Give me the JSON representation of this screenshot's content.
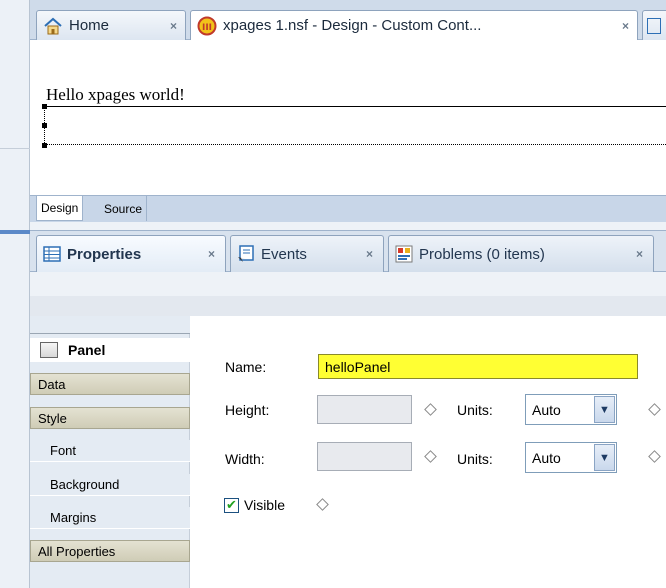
{
  "editor_tabs": [
    {
      "label": "Home",
      "close": "×",
      "icon": "home-icon"
    },
    {
      "label": "xpages 1.nsf - Design - Custom Cont...",
      "close": "×",
      "icon": "domino-database-icon"
    }
  ],
  "canvas": {
    "hello_text": "Hello xpages world!"
  },
  "design_tabs": [
    "Design",
    "Source"
  ],
  "view_tabs": [
    {
      "label": "Properties",
      "close": "×",
      "icon": "properties-icon"
    },
    {
      "label": "Events",
      "close": "×",
      "icon": "events-icon"
    },
    {
      "label": "Problems (0 items)",
      "close": "×",
      "icon": "problems-icon"
    }
  ],
  "sidenav": {
    "header": "Panel",
    "items": [
      {
        "label": "Data",
        "kind": "category"
      },
      {
        "label": "Style",
        "kind": "category"
      },
      {
        "label": "Font",
        "kind": "sub"
      },
      {
        "label": "Background",
        "kind": "sub"
      },
      {
        "label": "Margins",
        "kind": "sub"
      },
      {
        "label": "All Properties",
        "kind": "category"
      }
    ]
  },
  "form": {
    "name_label": "Name:",
    "name_value": "helloPanel",
    "height_label": "Height:",
    "width_label": "Width:",
    "units_label": "Units:",
    "height_units": "Auto",
    "width_units": "Auto",
    "visible_label": "Visible",
    "visible_checked": true
  },
  "colors": {
    "name_highlight": "#ffff33",
    "tab_bg": "#cfdbea",
    "category_bg": "#d8d6c2",
    "checkmark": "#21a121"
  }
}
